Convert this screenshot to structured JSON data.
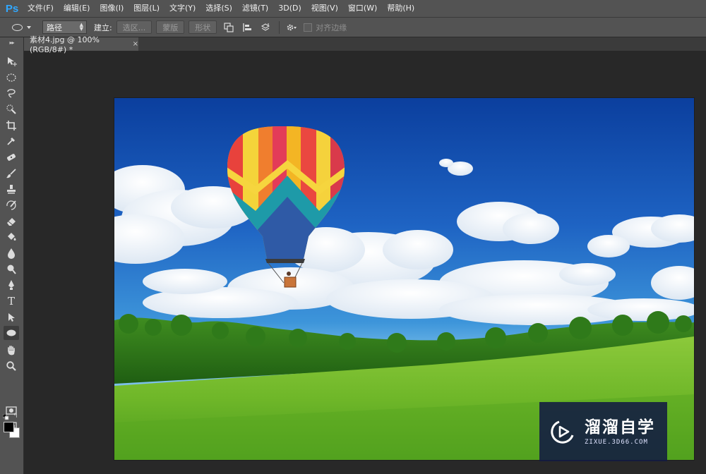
{
  "app": {
    "logo_text": "Ps"
  },
  "menu": [
    "文件(F)",
    "编辑(E)",
    "图像(I)",
    "图层(L)",
    "文字(Y)",
    "选择(S)",
    "滤镜(T)",
    "3D(D)",
    "视图(V)",
    "窗口(W)",
    "帮助(H)"
  ],
  "options_bar": {
    "tool_icon": "ellipse-tool-icon",
    "mode_value": "路径",
    "build_label": "建立:",
    "selection_button": "选区...",
    "mask_button": "蒙版",
    "shape_button": "形状",
    "align_edges_label": "对齐边缘",
    "align_edges_checked": false
  },
  "document_tab": {
    "title": "素材4.jpg @ 100%(RGB/8#) *",
    "close_glyph": "×"
  },
  "toolbar": {
    "grip": "▸▸",
    "tools": [
      "move-tool-icon",
      "marquee-tool-icon",
      "lasso-tool-icon",
      "quick-selection-tool-icon",
      "crop-tool-icon",
      "eyedropper-tool-icon",
      "healing-brush-tool-icon",
      "brush-tool-icon",
      "clone-stamp-tool-icon",
      "history-brush-tool-icon",
      "eraser-tool-icon",
      "paint-bucket-tool-icon",
      "blur-tool-icon",
      "dodge-tool-icon",
      "pen-tool-icon",
      "type-tool-icon",
      "path-selection-tool-icon",
      "ellipse-tool-icon",
      "hand-tool-icon",
      "zoom-tool-icon"
    ],
    "active_tool": "ellipse-tool-icon",
    "type_tool_glyph": "T",
    "foreground_color": "#000000",
    "background_color": "#ffffff"
  },
  "canvas_image": {
    "subject": "hot-air-balloon-over-green-meadow"
  },
  "watermark": {
    "title": "溜溜自学",
    "subtitle": "ZIXUE.3D66.COM"
  },
  "colors": {
    "ui_panel": "#535353",
    "workspace": "#282828",
    "accent_ps": "#31a8ff"
  }
}
